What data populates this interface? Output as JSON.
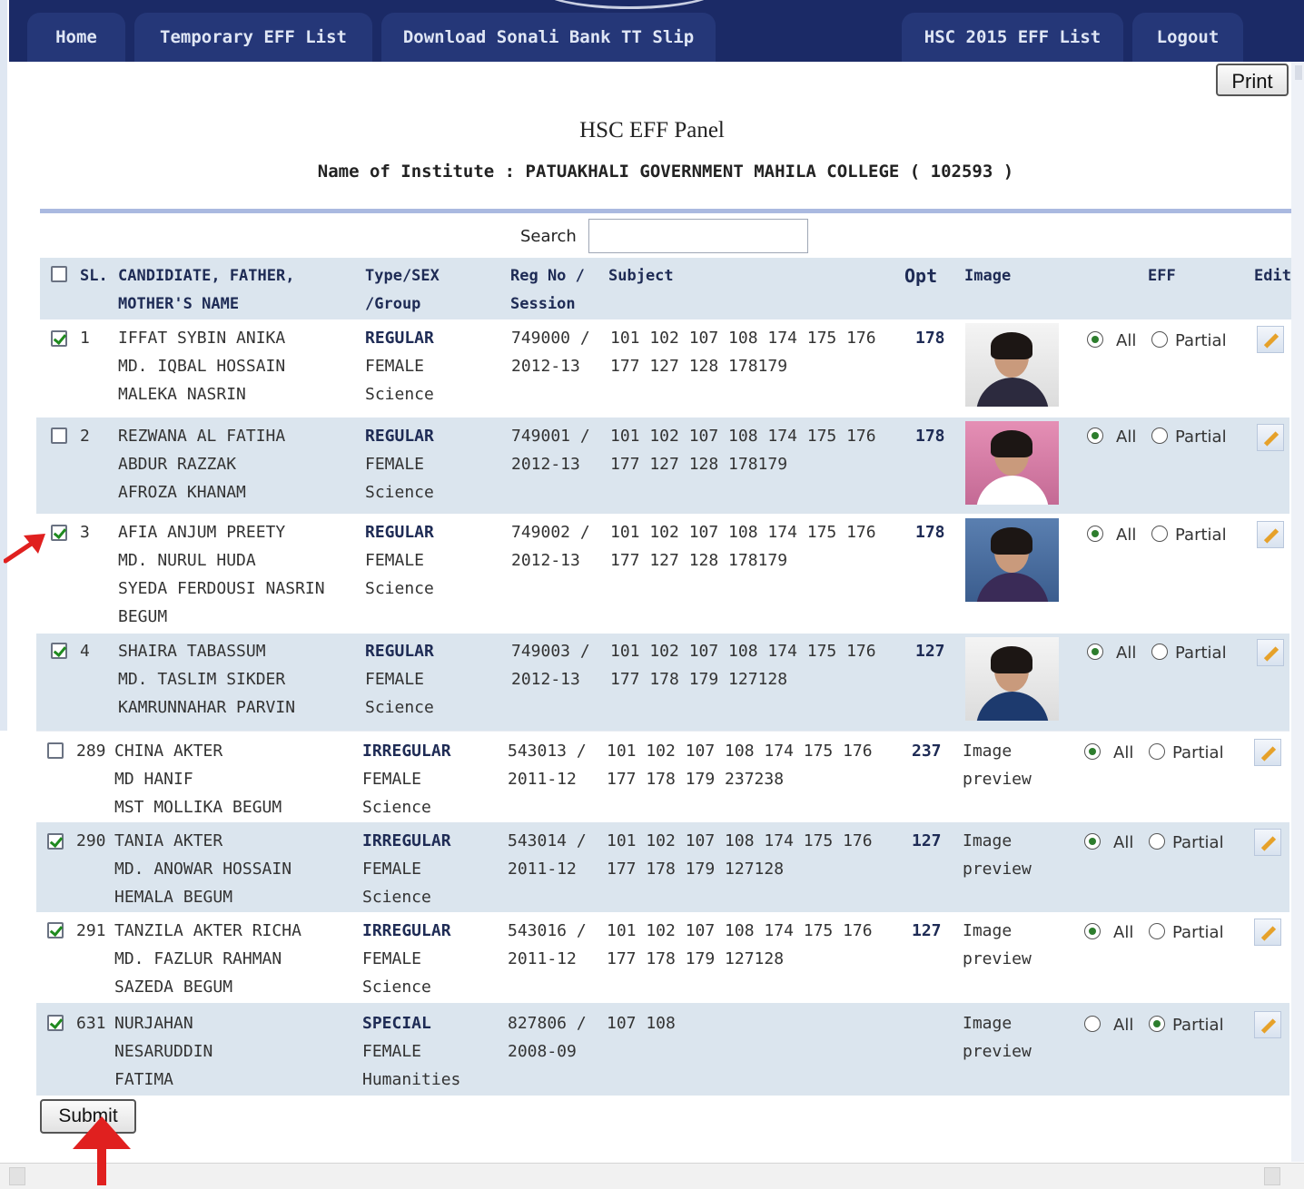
{
  "nav": {
    "tabs": [
      "Home",
      "Temporary EFF List",
      "Download Sonali Bank TT Slip",
      "HSC 2015 EFF List",
      "Logout"
    ]
  },
  "print_label": "Print",
  "panel_title": "HSC EFF Panel",
  "institute_line": "Name of Institute : PATUAKHALI GOVERNMENT MAHILA COLLEGE ( 102593 )",
  "search": {
    "label": "Search",
    "value": ""
  },
  "table": {
    "headers": {
      "sl": "SL.",
      "candidate": "CANDIDIATE, FATHER,\nMOTHER'S NAME",
      "type": "Type/SEX\n/Group",
      "reg": "Reg No /\nSession",
      "subject": "Subject",
      "opt": "Opt",
      "image": "Image",
      "eff": "EFF",
      "edit": "Edit"
    },
    "rows": [
      {
        "checked": true,
        "sl": "1",
        "names": "IFFAT SYBIN ANIKA\nMD. IQBAL HOSSAIN\nMALEKA NASRIN",
        "type": "REGULAR",
        "sexgroup": "FEMALE\nScience",
        "reg": "749000 /\n2012-13",
        "subject": "101 102 107 108 174 175 176\n177 127 128 178179",
        "opt": "178",
        "image": "photo",
        "eff": "All"
      },
      {
        "checked": false,
        "sl": "2",
        "names": "REZWANA AL FATIHA\nABDUR RAZZAK\nAFROZA KHANAM",
        "type": "REGULAR",
        "sexgroup": "FEMALE\nScience",
        "reg": "749001 /\n2012-13",
        "subject": "101 102 107 108 174 175 176\n177 127 128 178179",
        "opt": "178",
        "image": "photo",
        "eff": "All"
      },
      {
        "checked": true,
        "sl": "3",
        "names": "AFIA ANJUM PREETY\nMD. NURUL HUDA\nSYEDA FERDOUSI NASRIN\nBEGUM",
        "type": "REGULAR",
        "sexgroup": "FEMALE\nScience",
        "reg": "749002 /\n2012-13",
        "subject": "101 102 107 108 174 175 176\n177 127 128 178179",
        "opt": "178",
        "image": "photo",
        "eff": "All"
      },
      {
        "checked": true,
        "sl": "4",
        "names": "SHAIRA TABASSUM\nMD. TASLIM SIKDER\nKAMRUNNAHAR PARVIN",
        "type": "REGULAR",
        "sexgroup": "FEMALE\nScience",
        "reg": "749003 /\n2012-13",
        "subject": "101 102 107 108 174 175 176\n177 178 179 127128",
        "opt": "127",
        "image": "photo",
        "eff": "All"
      },
      {
        "checked": false,
        "sl": "289",
        "names": "CHINA AKTER\nMD HANIF\nMST MOLLIKA BEGUM",
        "type": "IRREGULAR",
        "sexgroup": "FEMALE\nScience",
        "reg": "543013 /\n2011-12",
        "subject": "101 102 107 108 174 175 176\n177 178 179 237238",
        "opt": "237",
        "image": "Image\npreview",
        "eff": "All"
      },
      {
        "checked": true,
        "sl": "290",
        "names": "TANIA AKTER\nMD. ANOWAR HOSSAIN\nHEMALA BEGUM",
        "type": "IRREGULAR",
        "sexgroup": "FEMALE\nScience",
        "reg": "543014 /\n2011-12",
        "subject": "101 102 107 108 174 175 176\n177 178 179 127128",
        "opt": "127",
        "image": "Image\npreview",
        "eff": "All"
      },
      {
        "checked": true,
        "sl": "291",
        "names": "TANZILA AKTER RICHA\nMD. FAZLUR RAHMAN\nSAZEDA BEGUM",
        "type": "IRREGULAR",
        "sexgroup": "FEMALE\nScience",
        "reg": "543016 /\n2011-12",
        "subject": "101 102 107 108 174 175 176\n177 178 179 127128",
        "opt": "127",
        "image": "Image\npreview",
        "eff": "All"
      },
      {
        "checked": true,
        "sl": "631",
        "names": "NURJAHAN\nNESARUDDIN\nFATIMA",
        "type": "SPECIAL",
        "sexgroup": "FEMALE\nHumanities",
        "reg": "827806 /\n2008-09",
        "subject": "107 108",
        "opt": "",
        "image": "Image\npreview",
        "eff": "Partial"
      }
    ],
    "radio_labels": {
      "all": "All",
      "partial": "Partial"
    }
  },
  "submit_label": "Submit",
  "colors": {
    "nav_bg": "#1b2a66",
    "row_shade": "#dbe5ee",
    "annotation_arrow": "#e0201f"
  }
}
